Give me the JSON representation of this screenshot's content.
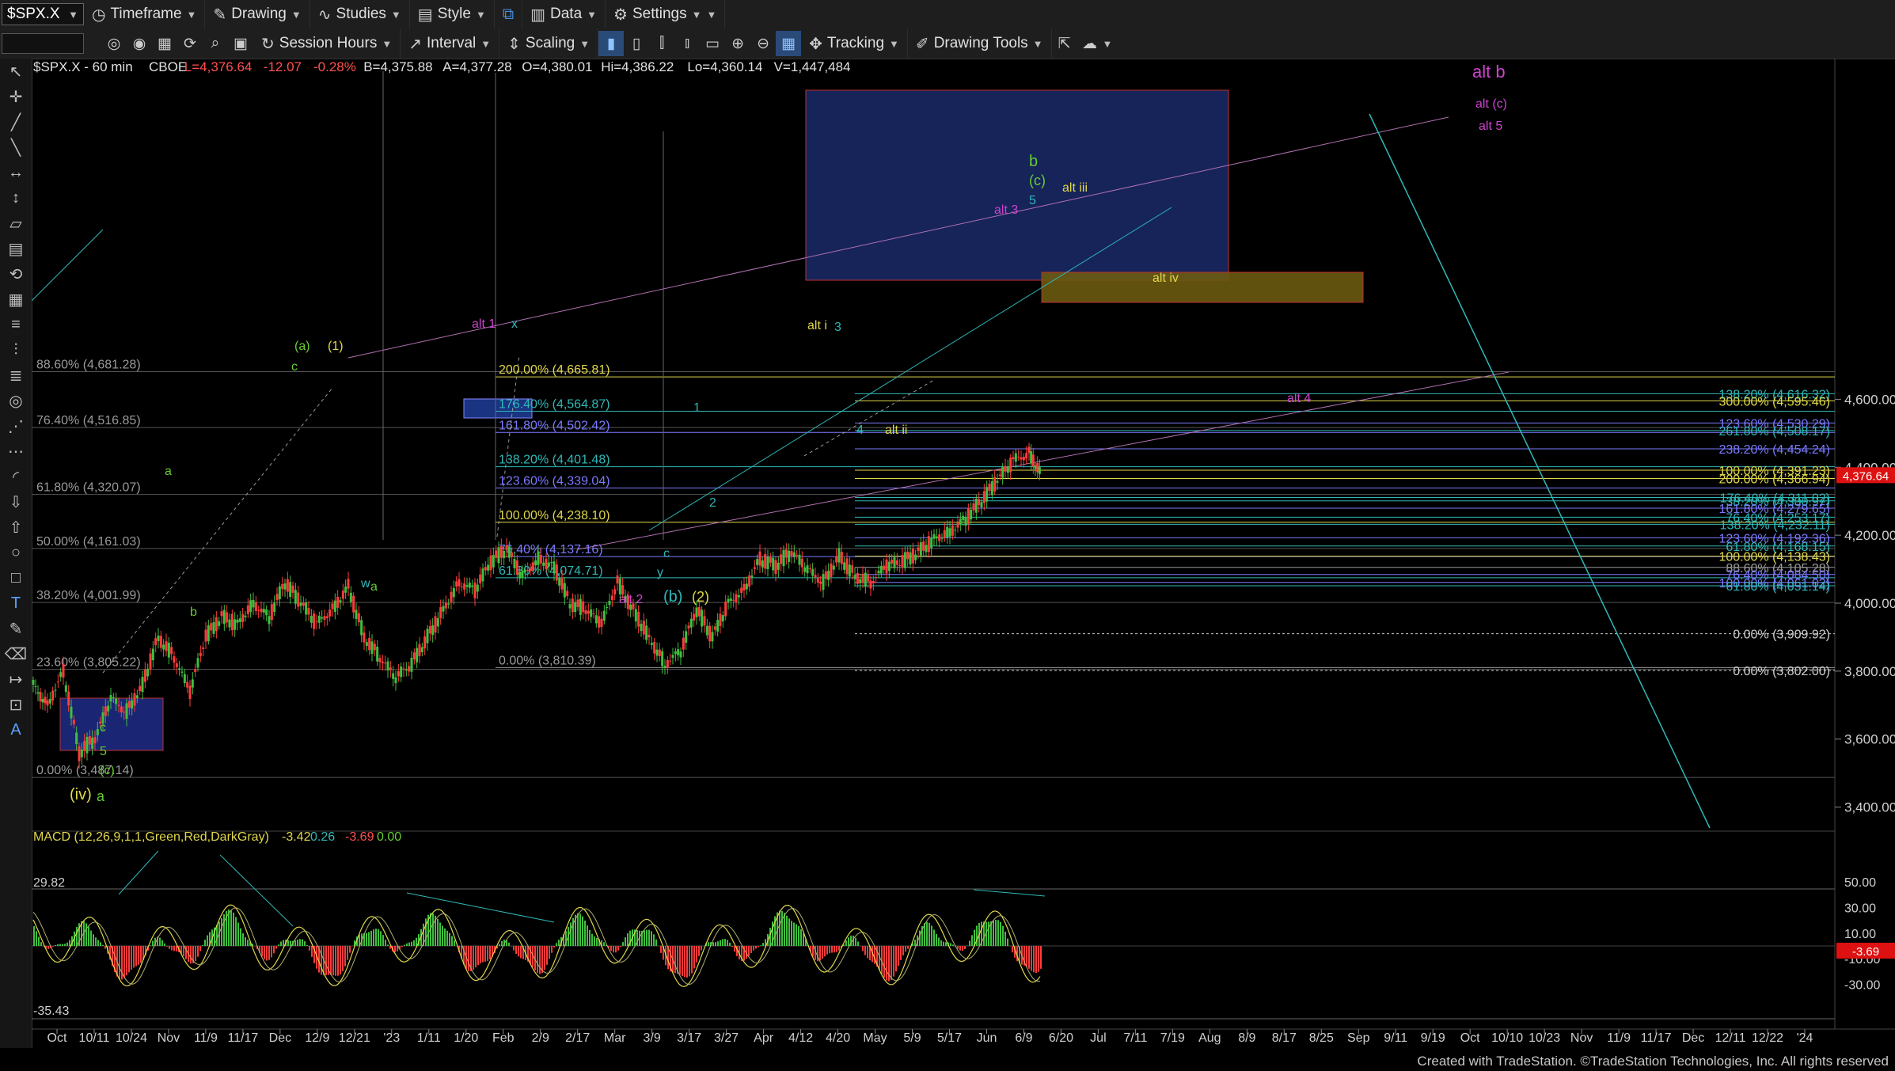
{
  "toolbar1": {
    "symbol": "$SPX.X",
    "timeframe": "Timeframe",
    "drawing": "Drawing",
    "studies": "Studies",
    "style": "Style",
    "data": "Data",
    "settings": "Settings"
  },
  "toolbar2": {
    "session_hours": "Session Hours",
    "interval": "Interval",
    "scaling": "Scaling",
    "tracking": "Tracking",
    "drawing_tools": "Drawing Tools"
  },
  "sidebar_icons": [
    "cursor-icon",
    "crosshair-icon",
    "trendline-icon",
    "ray-icon",
    "horizontal-line-icon",
    "vertical-line-icon",
    "channel-icon",
    "gann-icon",
    "fib-icon",
    "grid-icon",
    "fib-extension-icon",
    "fib-time-icon",
    "levels-icon",
    "spiral-icon",
    "speed-lines-icon",
    "regression-icon",
    "arc-icon",
    "arrow-down-icon",
    "arrow-up-icon",
    "ellipse-icon",
    "rectangle-icon",
    "text-icon",
    "pencil-icon",
    "eraser-icon",
    "ruler-icon",
    "magnet-icon",
    "label-icon"
  ],
  "chart": {
    "header": {
      "symbol": "$SPX.X - 60 min",
      "exchange": "CBOE",
      "last": "L=4,376.64",
      "change": "-12.07",
      "change_pct": "-0.28%",
      "bid": "B=4,375.88",
      "ask": "A=4,377.28",
      "open": "O=4,380.01",
      "high": "Hi=4,386.22",
      "low": "Lo=4,360.14",
      "volume": "V=1,447,484"
    },
    "current_price": "4,376.64",
    "y_ticks": [
      "4,600.00",
      "4,400.00",
      "4,200.00",
      "4,000.00",
      "3,800.00",
      "3,600.00",
      "3,400.00"
    ],
    "x_ticks": [
      "Oct",
      "10/11",
      "10/24",
      "Nov",
      "11/9",
      "11/17",
      "Dec",
      "12/9",
      "12/21",
      "'23",
      "1/11",
      "1/20",
      "Feb",
      "2/9",
      "2/17",
      "Mar",
      "3/9",
      "3/17",
      "3/27",
      "Apr",
      "4/12",
      "4/20",
      "May",
      "5/9",
      "5/17",
      "Jun",
      "6/9",
      "6/20",
      "Jul",
      "7/11",
      "7/19",
      "Aug",
      "8/9",
      "8/17",
      "8/25",
      "Sep",
      "9/11",
      "9/19",
      "Oct",
      "10/10",
      "10/23",
      "Nov",
      "11/9",
      "11/17",
      "Dec",
      "12/11",
      "12/22",
      "'24"
    ],
    "fib_left": [
      "88.60% (4,681.28)",
      "76.40% (4,516.85)",
      "61.80% (4,320.07)",
      "50.00% (4,161.03)",
      "38.20% (4,001.99)",
      "23.60% (3,805.22)",
      "0.00% (3,487.14)"
    ],
    "fib_mid": [
      "200.00% (4,665.81)",
      "176.40% (4,564.87)",
      "161.80% (4,502.42)",
      "138.20% (4,401.48)",
      "123.60% (4,339.04)",
      "100.00% (4,238.10)",
      "76.40% (4,137.16)",
      "61.80% (4,074.71)",
      "0.00% (3,810.39)"
    ],
    "fib_right": [
      "138.20% (4,616.32)",
      "300.00% (4,595.46)",
      "123.60% (4,530.29)",
      "261.80% (4,508.17)",
      "238.20% (4,454.24)",
      "100.00% (4,391.23)",
      "200.00% (4,366.94)",
      "176.40% (4,311.02)",
      "38.20% (4,300.97)",
      "161.80% (4,279.65)",
      "76.40% (4,253.17)",
      "138.20% (4,232.11)",
      "123.60% (4,192.36)",
      "61.80% (4,168.15)",
      "100.00% (4,138.43)",
      "88.60% (4,105.28)",
      "76.40% (4,084.50)",
      "100.00% (4,061.02)",
      "61.80% (4,051.14)",
      "0.00% (3,909.92)",
      "0.00% (3,802.00)"
    ],
    "wave_labels": {
      "alt_b": "alt b",
      "alt_c_paren": "alt (c)",
      "alt_5": "alt 5",
      "b": "b",
      "c_paren": "(c)",
      "five": "5",
      "alt_iii": "alt iii",
      "alt_3": "alt 3",
      "alt_iv": "alt iv",
      "alt_i": "alt i",
      "three": "3",
      "alt_1": "alt 1",
      "x": "x",
      "a_paren": "(a)",
      "one_paren": "(1)",
      "c": "c",
      "a": "a",
      "b_small": "b",
      "w": "w",
      "one": "1",
      "two": "2",
      "four": "4",
      "alt_ii": "alt ii",
      "y": "y",
      "b_paren": "(b)",
      "two_paren": "(2)",
      "alt_2": "alt 2",
      "alt_4": "alt 4",
      "iv_paren": "(iv)",
      "c_paren_low": "(c)"
    },
    "macd": {
      "title": "MACD (12,26,9,1,1,Green,Red,DarkGray)",
      "v1": "-3.42",
      "v2": "0.26",
      "v3": "-3.69",
      "v4": "0.00",
      "hi_label": "29.82",
      "lo_label": "-35.43",
      "current": "-3.69",
      "y_ticks": [
        "50.00",
        "30.00",
        "10.00",
        "-10.00",
        "-30.00"
      ]
    }
  },
  "status": "Created with TradeStation. ©TradeStation Technologies, Inc. All rights reserved",
  "colors": {
    "up_bar": "#3fbf3f",
    "down_bar": "#ff3b3b",
    "teal": "#2fb8b8",
    "yellow": "#e0d84a",
    "magenta": "#cc44cc",
    "green_label": "#66cc33",
    "price_box": "#d11"
  }
}
